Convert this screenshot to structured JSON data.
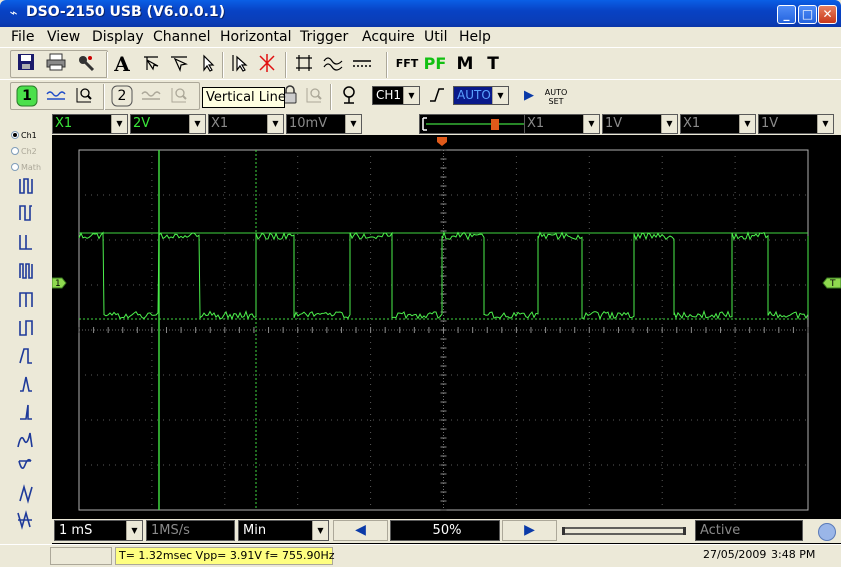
{
  "window": {
    "title": "DSO-2150 USB (V6.0.0.1)",
    "icon": "oscilloscope-app-icon",
    "buttons": {
      "minimize": "_",
      "maximize": "□",
      "close": "✕"
    }
  },
  "menu": [
    "File",
    "View",
    "Display",
    "Channel",
    "Horizontal",
    "Trigger",
    "Acquire",
    "Util",
    "Help"
  ],
  "toolbar1": {
    "icons": [
      "save-icon",
      "print-icon",
      "probe-icon",
      "text-icon",
      "cursor-cross-icon",
      "cursor-select-icon",
      "pointer-icon",
      "cursor-move-icon",
      "cross-cursor-icon",
      "rectangle-icon",
      "wave-compare-icon",
      "dotted-line-icon"
    ],
    "text_icon_label": "A",
    "fft_label": "FFT",
    "pf_label": "PF",
    "m_label": "M",
    "t_label": "T"
  },
  "toolbar2": {
    "ch1_number": "1",
    "ch2_number": "2",
    "ch1_select": "CH1",
    "trigger_mode": "AUTO",
    "autoset_label_1": "AUTO",
    "autoset_label_2": "SET"
  },
  "tooltip": "Vertical Line",
  "channel_row": {
    "ch1_probe": "X1",
    "ch1_volts": "2V",
    "ch2_probe": "X1",
    "ch2_volts": "10mV",
    "ch3_probe": "X1",
    "ch3_volts": "1V",
    "ch4_probe": "X1",
    "ch4_volts": "1V"
  },
  "left_panel": {
    "radios": [
      {
        "label": "Ch1",
        "checked": true
      },
      {
        "label": "Ch2",
        "checked": false
      },
      {
        "label": "Math",
        "checked": false
      }
    ]
  },
  "scope": {
    "ch1_marker": "1",
    "trigger_marker": "T",
    "colors": {
      "trace": "#4cf04c",
      "grid": "#5a5a5a",
      "cursor": "#3fd63f"
    }
  },
  "bottom_row": {
    "timebase": "1 mS",
    "sample_rate": "1MS/s",
    "memory": "Min",
    "position": "50%",
    "status": "Active"
  },
  "statusbar": {
    "measurements": "T= 1.32msec  Vpp= 3.91V  f= 755.90Hz",
    "date": "27/05/2009",
    "time": "3:48 PM"
  }
}
